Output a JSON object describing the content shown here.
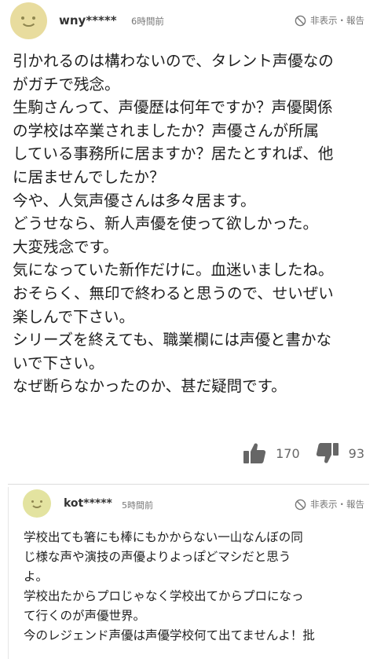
{
  "comments": [
    {
      "username": "wny*****",
      "time": "6時間前",
      "actions_label": "非表示・報告",
      "lines": [
        "引かれるのは構わないので、タレント声優なの",
        "がガチで残念。",
        "生駒さんって、声優歴は何年ですか？声優関係",
        "の学校は卒業されましたか？声優さんが所属",
        "している事務所に居ますか？居たとすれば、他",
        "に居ませんでしたか？",
        "今や、人気声優さんは多々居ます。",
        "どうせなら、新人声優を使って欲しかった。",
        "大変残念です。",
        "気になっていた新作だけに。血迷いましたね。",
        "おそらく、無印で終わると思うので、せいぜい",
        "楽しんで下さい。",
        "シリーズを終えても、職業欄には声優と書かな",
        "いで下さい。",
        "なぜ断らなかったのか、甚だ疑問です。"
      ],
      "likes": "170",
      "dislikes": "93"
    },
    {
      "username": "kot*****",
      "time": "5時間前",
      "actions_label": "非表示・報告",
      "lines": [
        "学校出ても箸にも棒にもかからない一山なんぼの同",
        "じ様な声や演技の声優よりよっぽどマシだと思う",
        "よ。",
        "学校出たからプロじゃなく学校出てからプロになっ",
        "て行くのが声優世界。",
        "今のレジェンド声優は声優学校何て出てませんよ！批"
      ]
    }
  ],
  "icons": {
    "avatar": "smiley-avatar-icon",
    "hide": "ban-icon",
    "like": "thumbs-up-icon",
    "dislike": "thumbs-down-icon"
  },
  "colors": {
    "avatar_bg": "#e8dc9e",
    "icon_gray": "#777777"
  }
}
